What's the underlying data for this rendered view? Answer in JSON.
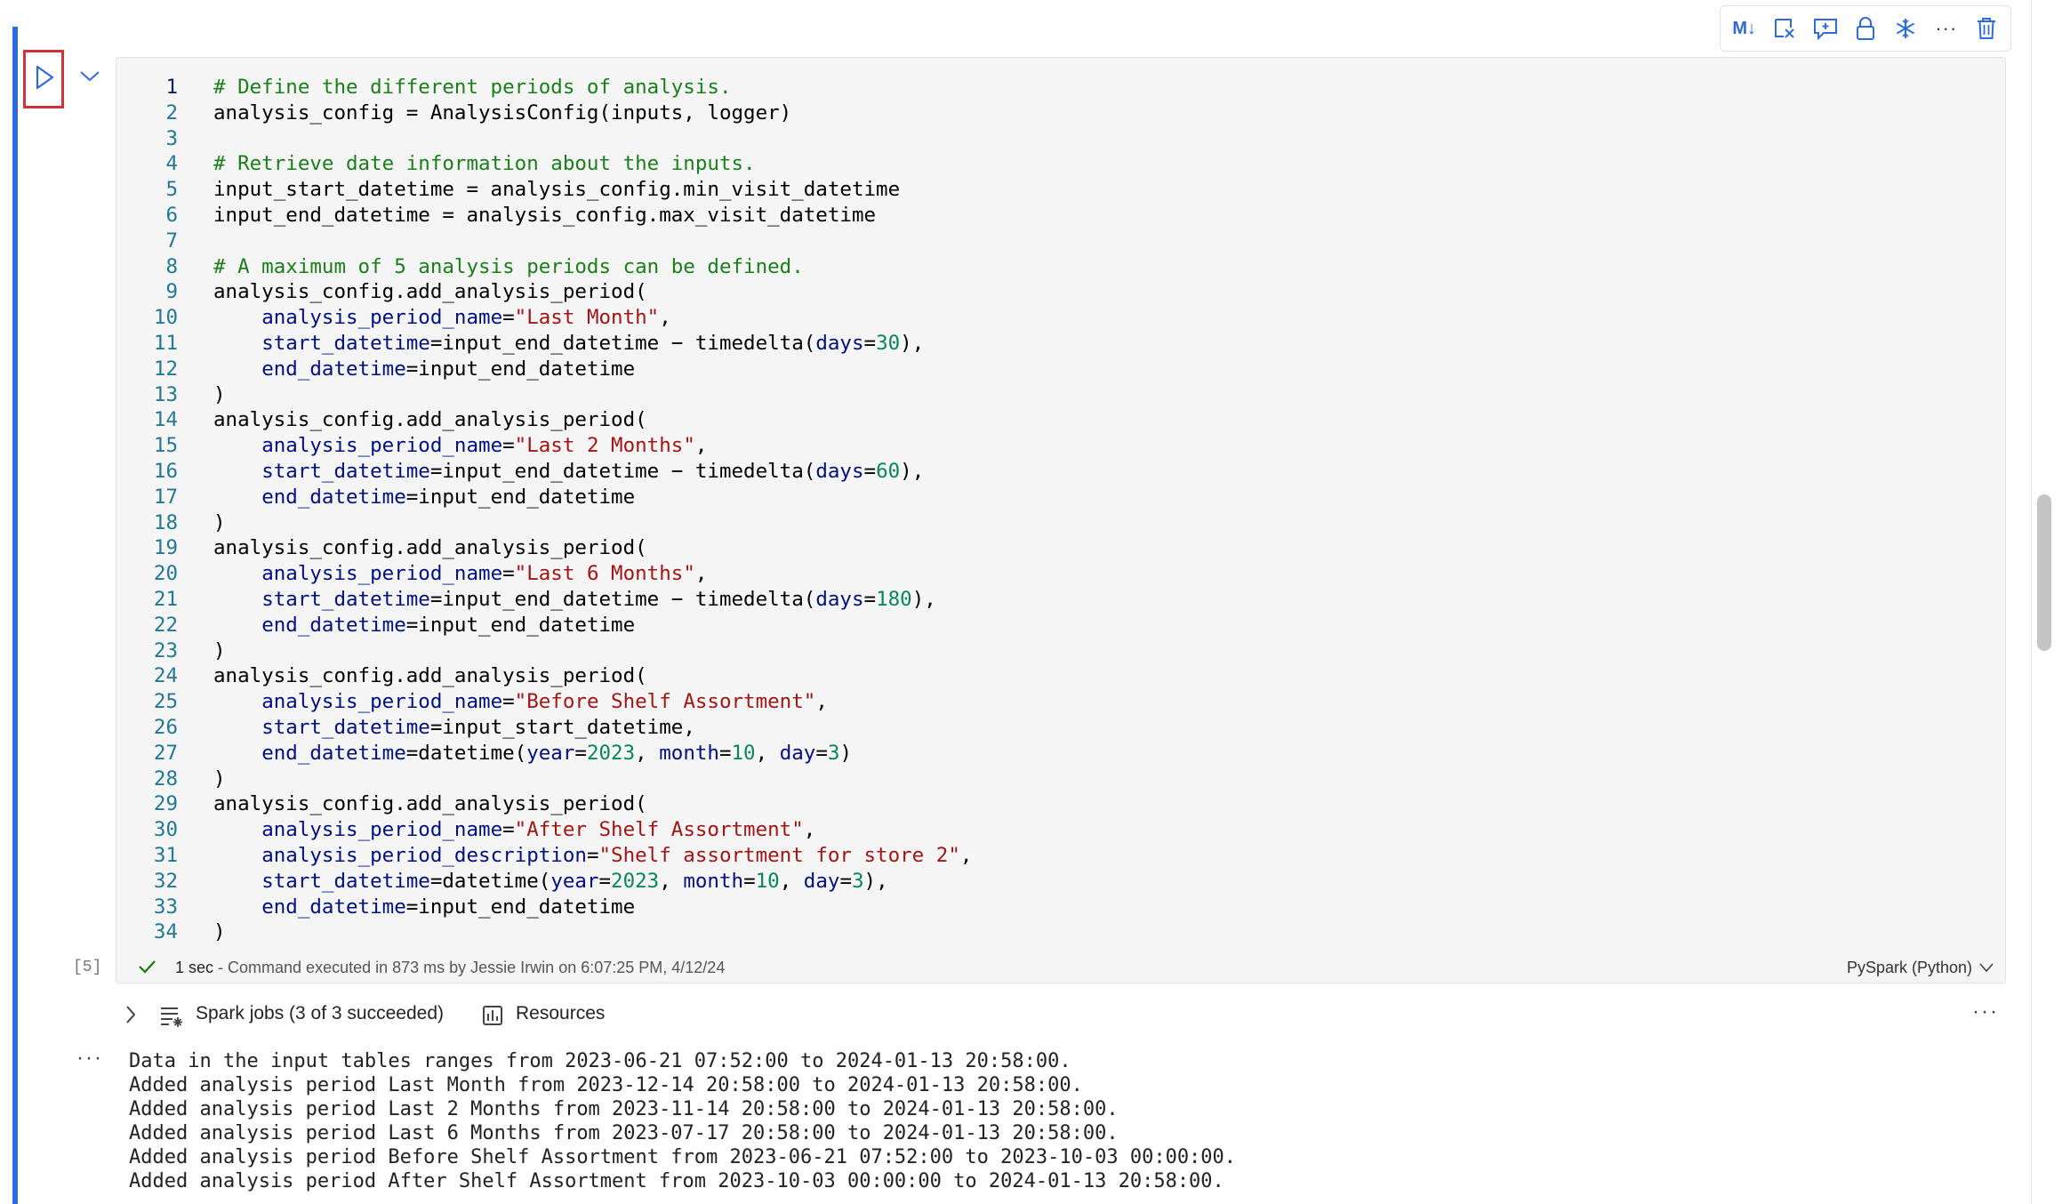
{
  "toolbar": {
    "markdown_label": "M↓",
    "more_label": "···"
  },
  "cell": {
    "execution_count": "[5]",
    "active_line": 1,
    "code": [
      [
        {
          "t": "# Define the different periods of analysis.",
          "c": "cm"
        }
      ],
      [
        {
          "t": "analysis_config = AnalysisConfig(inputs, logger)",
          "c": "src"
        }
      ],
      [],
      [
        {
          "t": "# Retrieve date information about the inputs.",
          "c": "cm"
        }
      ],
      [
        {
          "t": "input_start_datetime = analysis_config.min_visit_datetime",
          "c": "src"
        }
      ],
      [
        {
          "t": "input_end_datetime = analysis_config.max_visit_datetime",
          "c": "src"
        }
      ],
      [],
      [
        {
          "t": "# A maximum of 5 analysis periods can be defined.",
          "c": "cm"
        }
      ],
      [
        {
          "t": "analysis_config.add_analysis_period(",
          "c": "src"
        }
      ],
      [
        {
          "t": "    ",
          "c": "src"
        },
        {
          "t": "analysis_period_name",
          "c": "kw"
        },
        {
          "t": "=",
          "c": "src"
        },
        {
          "t": "\"Last Month\"",
          "c": "st"
        },
        {
          "t": ",",
          "c": "src"
        }
      ],
      [
        {
          "t": "    ",
          "c": "src"
        },
        {
          "t": "start_datetime",
          "c": "kw"
        },
        {
          "t": "=input_end_datetime − timedelta(",
          "c": "src"
        },
        {
          "t": "days",
          "c": "kw"
        },
        {
          "t": "=",
          "c": "src"
        },
        {
          "t": "30",
          "c": "nu"
        },
        {
          "t": "),",
          "c": "src"
        }
      ],
      [
        {
          "t": "    ",
          "c": "src"
        },
        {
          "t": "end_datetime",
          "c": "kw"
        },
        {
          "t": "=input_end_datetime",
          "c": "src"
        }
      ],
      [
        {
          "t": ")",
          "c": "src"
        }
      ],
      [
        {
          "t": "analysis_config.add_analysis_period(",
          "c": "src"
        }
      ],
      [
        {
          "t": "    ",
          "c": "src"
        },
        {
          "t": "analysis_period_name",
          "c": "kw"
        },
        {
          "t": "=",
          "c": "src"
        },
        {
          "t": "\"Last 2 Months\"",
          "c": "st"
        },
        {
          "t": ",",
          "c": "src"
        }
      ],
      [
        {
          "t": "    ",
          "c": "src"
        },
        {
          "t": "start_datetime",
          "c": "kw"
        },
        {
          "t": "=input_end_datetime − timedelta(",
          "c": "src"
        },
        {
          "t": "days",
          "c": "kw"
        },
        {
          "t": "=",
          "c": "src"
        },
        {
          "t": "60",
          "c": "nu"
        },
        {
          "t": "),",
          "c": "src"
        }
      ],
      [
        {
          "t": "    ",
          "c": "src"
        },
        {
          "t": "end_datetime",
          "c": "kw"
        },
        {
          "t": "=input_end_datetime",
          "c": "src"
        }
      ],
      [
        {
          "t": ")",
          "c": "src"
        }
      ],
      [
        {
          "t": "analysis_config.add_analysis_period(",
          "c": "src"
        }
      ],
      [
        {
          "t": "    ",
          "c": "src"
        },
        {
          "t": "analysis_period_name",
          "c": "kw"
        },
        {
          "t": "=",
          "c": "src"
        },
        {
          "t": "\"Last 6 Months\"",
          "c": "st"
        },
        {
          "t": ",",
          "c": "src"
        }
      ],
      [
        {
          "t": "    ",
          "c": "src"
        },
        {
          "t": "start_datetime",
          "c": "kw"
        },
        {
          "t": "=input_end_datetime − timedelta(",
          "c": "src"
        },
        {
          "t": "days",
          "c": "kw"
        },
        {
          "t": "=",
          "c": "src"
        },
        {
          "t": "180",
          "c": "nu"
        },
        {
          "t": "),",
          "c": "src"
        }
      ],
      [
        {
          "t": "    ",
          "c": "src"
        },
        {
          "t": "end_datetime",
          "c": "kw"
        },
        {
          "t": "=input_end_datetime",
          "c": "src"
        }
      ],
      [
        {
          "t": ")",
          "c": "src"
        }
      ],
      [
        {
          "t": "analysis_config.add_analysis_period(",
          "c": "src"
        }
      ],
      [
        {
          "t": "    ",
          "c": "src"
        },
        {
          "t": "analysis_period_name",
          "c": "kw"
        },
        {
          "t": "=",
          "c": "src"
        },
        {
          "t": "\"Before Shelf Assortment\"",
          "c": "st"
        },
        {
          "t": ",",
          "c": "src"
        }
      ],
      [
        {
          "t": "    ",
          "c": "src"
        },
        {
          "t": "start_datetime",
          "c": "kw"
        },
        {
          "t": "=input_start_datetime,",
          "c": "src"
        }
      ],
      [
        {
          "t": "    ",
          "c": "src"
        },
        {
          "t": "end_datetime",
          "c": "kw"
        },
        {
          "t": "=datetime(",
          "c": "src"
        },
        {
          "t": "year",
          "c": "kw"
        },
        {
          "t": "=",
          "c": "src"
        },
        {
          "t": "2023",
          "c": "nu"
        },
        {
          "t": ", ",
          "c": "src"
        },
        {
          "t": "month",
          "c": "kw"
        },
        {
          "t": "=",
          "c": "src"
        },
        {
          "t": "10",
          "c": "nu"
        },
        {
          "t": ", ",
          "c": "src"
        },
        {
          "t": "day",
          "c": "kw"
        },
        {
          "t": "=",
          "c": "src"
        },
        {
          "t": "3",
          "c": "nu"
        },
        {
          "t": ")",
          "c": "src"
        }
      ],
      [
        {
          "t": ")",
          "c": "src"
        }
      ],
      [
        {
          "t": "analysis_config.add_analysis_period(",
          "c": "src"
        }
      ],
      [
        {
          "t": "    ",
          "c": "src"
        },
        {
          "t": "analysis_period_name",
          "c": "kw"
        },
        {
          "t": "=",
          "c": "src"
        },
        {
          "t": "\"After Shelf Assortment\"",
          "c": "st"
        },
        {
          "t": ",",
          "c": "src"
        }
      ],
      [
        {
          "t": "    ",
          "c": "src"
        },
        {
          "t": "analysis_period_description",
          "c": "kw"
        },
        {
          "t": "=",
          "c": "src"
        },
        {
          "t": "\"Shelf assortment for store 2\"",
          "c": "st"
        },
        {
          "t": ",",
          "c": "src"
        }
      ],
      [
        {
          "t": "    ",
          "c": "src"
        },
        {
          "t": "start_datetime",
          "c": "kw"
        },
        {
          "t": "=datetime(",
          "c": "src"
        },
        {
          "t": "year",
          "c": "kw"
        },
        {
          "t": "=",
          "c": "src"
        },
        {
          "t": "2023",
          "c": "nu"
        },
        {
          "t": ", ",
          "c": "src"
        },
        {
          "t": "month",
          "c": "kw"
        },
        {
          "t": "=",
          "c": "src"
        },
        {
          "t": "10",
          "c": "nu"
        },
        {
          "t": ", ",
          "c": "src"
        },
        {
          "t": "day",
          "c": "kw"
        },
        {
          "t": "=",
          "c": "src"
        },
        {
          "t": "3",
          "c": "nu"
        },
        {
          "t": "),",
          "c": "src"
        }
      ],
      [
        {
          "t": "    ",
          "c": "src"
        },
        {
          "t": "end_datetime",
          "c": "kw"
        },
        {
          "t": "=input_end_datetime",
          "c": "src"
        }
      ],
      [
        {
          "t": ")",
          "c": "src"
        }
      ]
    ]
  },
  "status": {
    "duration": "1 sec",
    "detail": " - Command executed in 873 ms by Jessie Irwin on 6:07:25 PM, 4/12/24",
    "kernel": "PySpark (Python)"
  },
  "jobs": {
    "label": "Spark jobs (3 of 3 succeeded)",
    "resources_label": "Resources",
    "more": "···"
  },
  "output": {
    "more": "···",
    "lines": [
      "Data in the input tables ranges from 2023-06-21 07:52:00 to 2024-01-13 20:58:00.",
      "Added analysis period Last Month from 2023-12-14 20:58:00 to 2024-01-13 20:58:00.",
      "Added analysis period Last 2 Months from 2023-11-14 20:58:00 to 2024-01-13 20:58:00.",
      "Added analysis period Last 6 Months from 2023-07-17 20:58:00 to 2024-01-13 20:58:00.",
      "Added analysis period Before Shelf Assortment from 2023-06-21 07:52:00 to 2023-10-03 00:00:00.",
      "Added analysis period After Shelf Assortment from 2023-10-03 00:00:00 to 2024-01-13 20:58:00."
    ]
  },
  "colors": {
    "accent": "#2f6ad9",
    "highlight": "#d13438",
    "comment": "#1a7f1a",
    "string": "#a31515",
    "number": "#098658",
    "keyword": "#001080"
  }
}
